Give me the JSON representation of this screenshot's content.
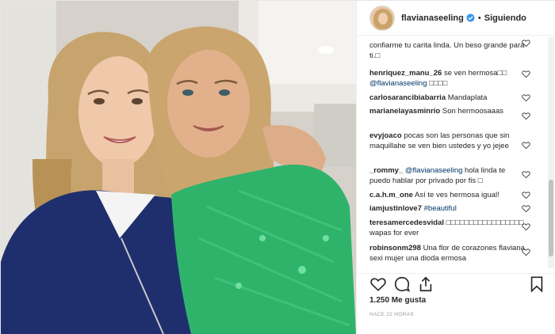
{
  "header": {
    "username": "flavianaseeling",
    "separator": "•",
    "follow_label": "Siguiendo"
  },
  "photo": {
    "description_icon": "photo-two-women-selfie"
  },
  "comments": [
    {
      "user": "",
      "text": "confiarme tu carita linda. Un beso grande para ti.□"
    },
    {
      "user": "henriquez_manu_26",
      "text": "se ven hermosa□□",
      "mention": "@flavianaseeling",
      "after": "□□□□"
    },
    {
      "user": "carlosarancibiabarria",
      "text": "Mandaplata"
    },
    {
      "user": "marianelayasminrio",
      "text": "Son hermoosaaas"
    },
    {
      "user": "evyjoaco",
      "text": "pocas son las personas que sin maquillahe se ven bien ustedes y yo jejee"
    },
    {
      "user": "_rommy_",
      "mention": "@flavianaseeling",
      "text": "hola linda te puedo hablar por privado por fis □"
    },
    {
      "user": "c.a.h.m_one",
      "text": "Así te ves hermosa igual!"
    },
    {
      "user": "iamjustinlove7",
      "mention": "#beautiful",
      "text": ""
    },
    {
      "user": "teresamercedesvidal",
      "text": "□□□□□□□□□□□□□□□□□ wapas for ever"
    },
    {
      "user": "robinsonm298",
      "text": "Una flor de corazones flaviana sexi mujer una dioda ermosa"
    }
  ],
  "footer": {
    "likes": "1.250 Me gusta",
    "time": "HACE 22 HORAS"
  },
  "colors": {
    "accent_blue": "#3897f0",
    "mention": "#003569",
    "text": "#262626",
    "muted": "#999999"
  },
  "icons": [
    "heart-icon",
    "comment-icon",
    "share-icon",
    "bookmark-icon",
    "verified-badge-icon"
  ]
}
